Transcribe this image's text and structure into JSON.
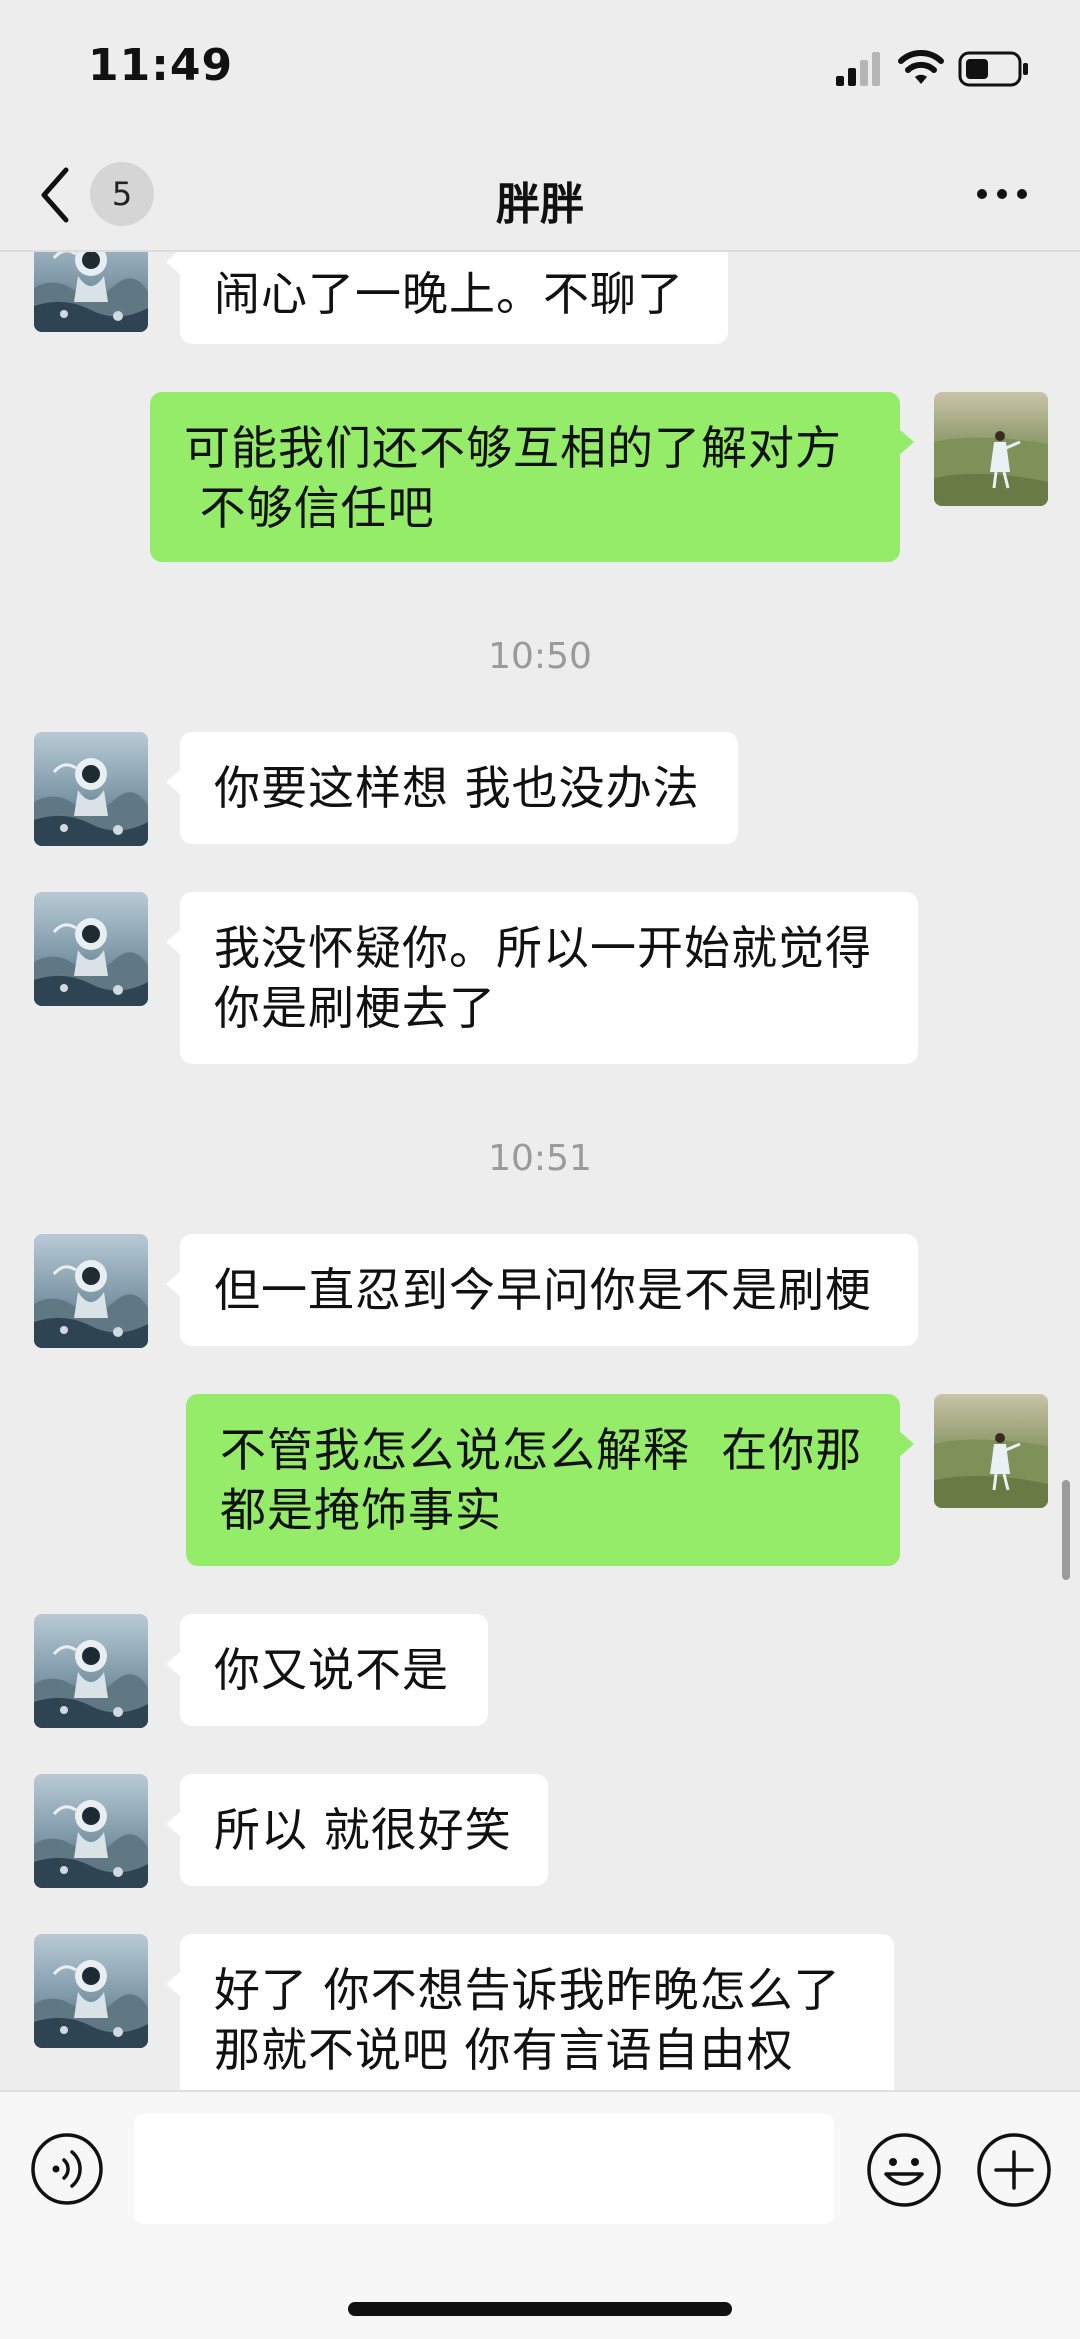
{
  "status": {
    "time": "11:49"
  },
  "nav": {
    "back_badge": "5",
    "title": "胖胖"
  },
  "messages": [
    {
      "side": "left",
      "text": "闹心了一晚上。不聊了"
    },
    {
      "side": "right",
      "text": "可能我们还不够互相的了解对方\n 不够信任吧"
    },
    {
      "timestamp": "10:50"
    },
    {
      "side": "left",
      "text": "你要这样想 我也没办法"
    },
    {
      "side": "left",
      "text": "我没怀疑你。所以一开始就觉得\n你是刷梗去了"
    },
    {
      "timestamp": "10:51"
    },
    {
      "side": "left",
      "text": "但一直忍到今早问你是不是刷梗"
    },
    {
      "side": "right",
      "text": "不管我怎么说怎么解释  在你那\n都是掩饰事实"
    },
    {
      "side": "left",
      "text": "你又说不是"
    },
    {
      "side": "left",
      "text": "所以 就很好笑"
    },
    {
      "side": "left",
      "text": "好了 你不想告诉我昨晚怎么了\n那就不说吧 你有言语自由权"
    }
  ],
  "input": {
    "value": ""
  },
  "icons": [
    "signal-icon",
    "wifi-icon",
    "battery-icon",
    "back-chevron-icon",
    "more-icon",
    "voice-icon",
    "emoji-icon",
    "plus-icon"
  ],
  "colors": {
    "background": "#ededed",
    "sent_bubble": "#95ec69",
    "received_bubble": "#ffffff",
    "timestamp": "#9a9a9a"
  }
}
